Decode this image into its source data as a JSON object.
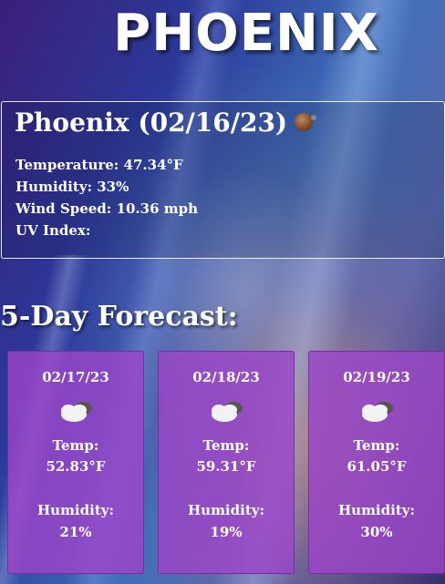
{
  "header": {
    "city_title": "PHOENIX"
  },
  "current": {
    "heading": "Phoenix (02/16/23)",
    "icon": "moon-clear-icon",
    "temperature": "Temperature: 47.34°F",
    "humidity": "Humidity: 33%",
    "wind": "Wind Speed: 10.36 mph",
    "uv": "UV Index:"
  },
  "forecast": {
    "title": "5-Day Forecast:",
    "temp_label": "Temp:",
    "humidity_label": "Humidity:",
    "days": [
      {
        "date": "02/17/23",
        "icon": "cloud-icon",
        "temp": "52.83°F",
        "humidity": "21%"
      },
      {
        "date": "02/18/23",
        "icon": "cloud-icon",
        "temp": "59.31°F",
        "humidity": "19%"
      },
      {
        "date": "02/19/23",
        "icon": "cloud-icon",
        "temp": "61.05°F",
        "humidity": "30%"
      }
    ]
  }
}
